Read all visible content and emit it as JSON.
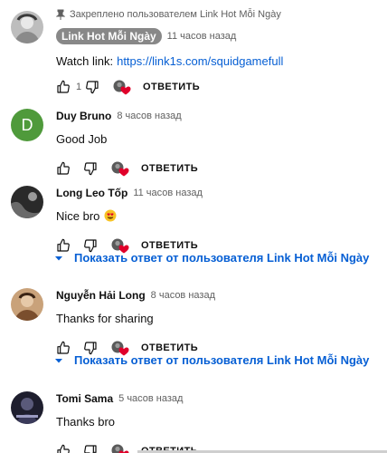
{
  "comments": [
    {
      "pinned_text": "Закреплено пользователем Link Hot Mỗi Ngày",
      "author": "Link Hot Mỗi Ngày",
      "time": "11 часов назад",
      "text": "Watch link:",
      "link": "https://link1s.com/squidgamefull",
      "likes": "1",
      "reply_label": "ОТВЕТИТЬ"
    },
    {
      "author": "Duy Bruno",
      "avatar_letter": "D",
      "time": "8 часов назад",
      "text": "Good Job",
      "reply_label": "ОТВЕТИТЬ"
    },
    {
      "author": "Long Leo Tốp",
      "time": "11 часов назад",
      "text": "Nice bro",
      "reply_label": "ОТВЕТИТЬ",
      "show_replies": "Показать ответ от пользователя Link Hot Mỗi Ngày"
    },
    {
      "author": "Nguyễn Hải Long",
      "time": "8 часов назад",
      "text": "Thanks for sharing",
      "reply_label": "ОТВЕТИТЬ",
      "show_replies": "Показать ответ от пользователя Link Hot Mỗi Ngày"
    },
    {
      "author": "Tomi Sama",
      "time": "5 часов назад",
      "text": "Thanks bro",
      "reply_label": "ОТВЕТИТЬ"
    }
  ],
  "colors": {
    "link": "#065fd4",
    "heart": "#e0002a",
    "avatar_green": "#4f9a3b"
  },
  "icons": [
    "pin-icon",
    "like-icon",
    "dislike-icon",
    "creator-heart-icon",
    "chevron-down-icon",
    "heart-eyes-emoji"
  ]
}
